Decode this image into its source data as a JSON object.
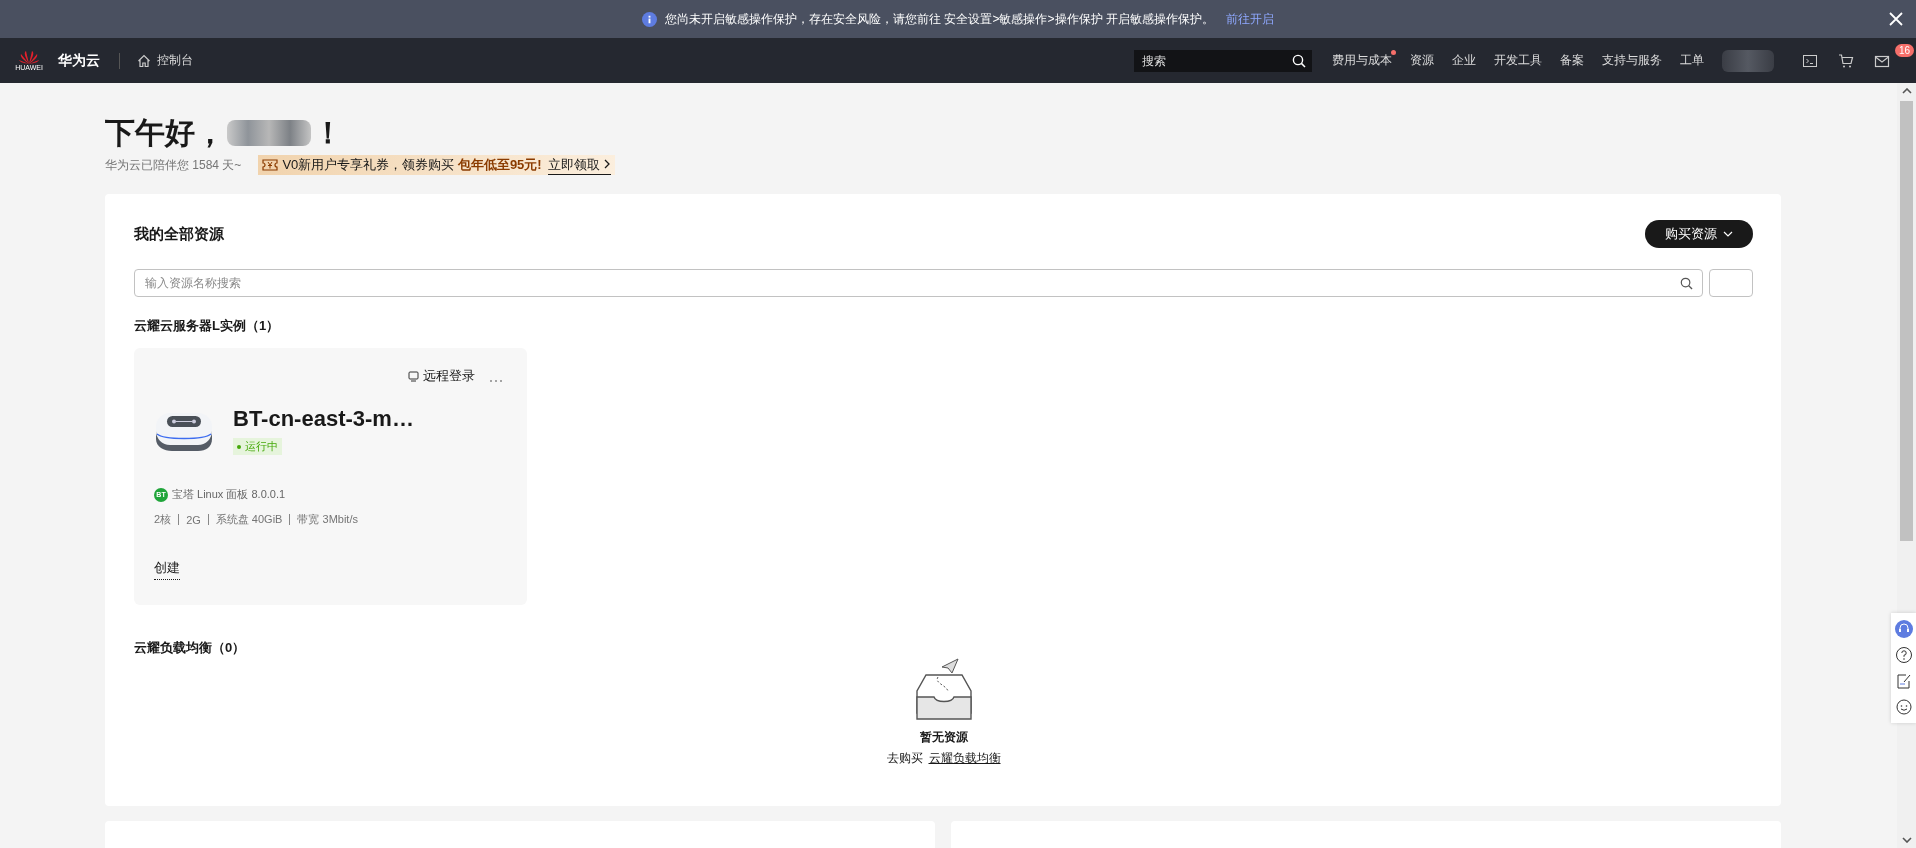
{
  "banner": {
    "message": "您尚未开启敏感操作保护，存在安全风险，请您前往 安全设置>敏感操作>操作保护 开启敏感操作保护。",
    "link": "前往开启"
  },
  "nav": {
    "logo_text": "HUAWEI",
    "brand": "华为云",
    "console": "控制台",
    "search_placeholder": "搜索",
    "links": [
      {
        "label": "费用与成本",
        "dot": true
      },
      {
        "label": "资源",
        "dot": false
      },
      {
        "label": "企业",
        "dot": false
      },
      {
        "label": "开发工具",
        "dot": false
      },
      {
        "label": "备案",
        "dot": false
      },
      {
        "label": "支持与服务",
        "dot": false
      },
      {
        "label": "工单",
        "dot": false
      }
    ],
    "mail_badge": "16"
  },
  "greeting": {
    "prefix": "下午好，",
    "suffix": "！",
    "days": "华为云已陪伴您 1584 天~",
    "promo": "V0新用户专享礼券，领券购买 **包年低至95元!**",
    "promo_link": "立即领取"
  },
  "resources": {
    "title": "我的全部资源",
    "buy_button": "购买资源",
    "search_placeholder": "输入资源名称搜索",
    "sections": [
      {
        "kind": "instances",
        "title": "云耀云服务器L实例（1）",
        "instances": [
          {
            "action": "远程登录",
            "name": "BT-cn-east-3-m…",
            "status": "运行中",
            "running": true,
            "image_badge": "BT",
            "image": "宝塔 Linux 面板 8.0.0.1",
            "specs": [
              "2核",
              "2G",
              "系统盘 40GiB",
              "带宽 3Mbit/s"
            ],
            "create": "创建"
          }
        ]
      },
      {
        "kind": "empty",
        "title": "云耀负载均衡（0）",
        "empty_title": "暂无资源",
        "empty_prefix": "去购买",
        "empty_link": "云耀负载均衡"
      }
    ]
  }
}
